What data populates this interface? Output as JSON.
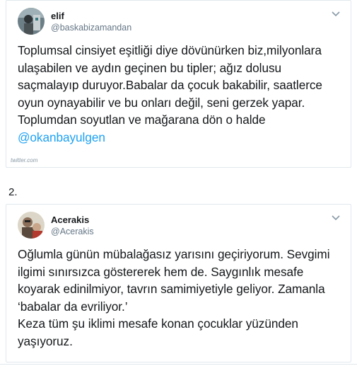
{
  "tweets": [
    {
      "display_name": "elif",
      "handle": "@baskabizamandan",
      "text": "Toplumsal cinsiyet eşitliği diye dövünürken biz,milyonlara\nulaşabilen ve aydın geçinen bu tipler; ağız dolusu\nsaçmalayıp duruyor.Babalar da çocuk bakabilir, saatlerce\noyun oynayabilir ve bu onları değil, seni gerzek yapar.\nToplumdan soyutlan ve mağarana dön o halde",
      "mention": "@okanbayulgen",
      "avatar_icon": "profile-photo-icon",
      "menu_icon": "chevron-down-icon"
    },
    {
      "display_name": "Acerakis",
      "handle": "@Acerakis",
      "text": "Oğlumla günün mübalağasız yarısını geçiriyorum. Sevgimi\nilgimi sınırsızca göstererek hem de. Saygınlık mesafe\nkoyarak edinilmiyor, tavrın samimiyetiyle geliyor. Zamanla\n‘babalar da evriliyor.’\nKeza tüm şu iklimi mesafe konan çocuklar yüzünden\nyaşıyoruz.",
      "avatar_icon": "profile-photo-icon",
      "menu_icon": "chevron-down-icon"
    }
  ],
  "source_label": "twitter.com",
  "section_number": "2.",
  "colors": {
    "mention": "#1da1f2",
    "handle": "#657786",
    "border": "#e1e8ed"
  }
}
